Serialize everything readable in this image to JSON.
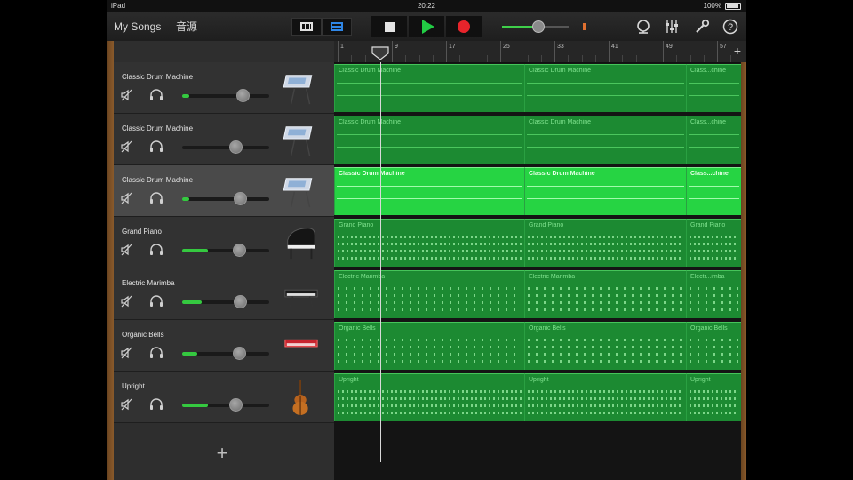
{
  "status_bar": {
    "device": "iPad",
    "time": "20:22",
    "battery": "100%"
  },
  "toolbar": {
    "my_songs": "My Songs",
    "sounds_button": "音源",
    "icons": [
      "tracks-grid-icon",
      "tracks-list-icon",
      "stop-icon",
      "play-icon",
      "record-icon",
      "metronome-icon",
      "mixer-icon",
      "settings-wrench-icon",
      "help-icon"
    ],
    "master_volume": 0.55
  },
  "ruler": {
    "bars": [
      "1",
      "9",
      "17",
      "25",
      "33",
      "41",
      "49",
      "57"
    ]
  },
  "colors": {
    "region": "#1c8a32",
    "region_selected": "#26d443",
    "slider_fill": "#35c940",
    "record": "#e8242b",
    "play": "#22cc44"
  },
  "tracks": [
    {
      "name": "Classic Drum Machine",
      "volume": 0.69,
      "fill": 0.08,
      "instrument_icon": "drum-machine-icon",
      "selected": false,
      "kind": "drum",
      "regions": [
        "Classic Drum Machine",
        "Classic Drum Machine",
        "Class...chine"
      ]
    },
    {
      "name": "Classic Drum Machine",
      "volume": 0.61,
      "fill": 0.0,
      "instrument_icon": "drum-machine-icon",
      "selected": false,
      "kind": "drum",
      "regions": [
        "Classic Drum Machine",
        "Classic Drum Machine",
        "Class...chine"
      ]
    },
    {
      "name": "Classic Drum Machine",
      "volume": 0.66,
      "fill": 0.08,
      "instrument_icon": "drum-machine-icon",
      "selected": true,
      "kind": "drum",
      "regions": [
        "Classic Drum Machine",
        "Classic Drum Machine",
        "Class...chine"
      ]
    },
    {
      "name": "Grand Piano",
      "volume": 0.65,
      "fill": 0.3,
      "instrument_icon": "grand-piano-icon",
      "selected": false,
      "kind": "dense",
      "regions": [
        "Grand Piano",
        "Grand Piano",
        "Grand Piano"
      ]
    },
    {
      "name": "Electric Marimba",
      "volume": 0.66,
      "fill": 0.22,
      "instrument_icon": "keyboard-icon",
      "selected": false,
      "kind": "sparse",
      "regions": [
        "Electric Marimba",
        "Electric Marimba",
        "Electr...imba"
      ]
    },
    {
      "name": "Organic Bells",
      "volume": 0.65,
      "fill": 0.17,
      "instrument_icon": "red-keyboard-icon",
      "selected": false,
      "kind": "sparse",
      "regions": [
        "Organic Bells",
        "Organic Bells",
        "Organic Bells"
      ]
    },
    {
      "name": "Upright",
      "volume": 0.61,
      "fill": 0.3,
      "instrument_icon": "upright-bass-icon",
      "selected": false,
      "kind": "dense",
      "regions": [
        "Upright",
        "Upright",
        "Upright"
      ]
    }
  ]
}
